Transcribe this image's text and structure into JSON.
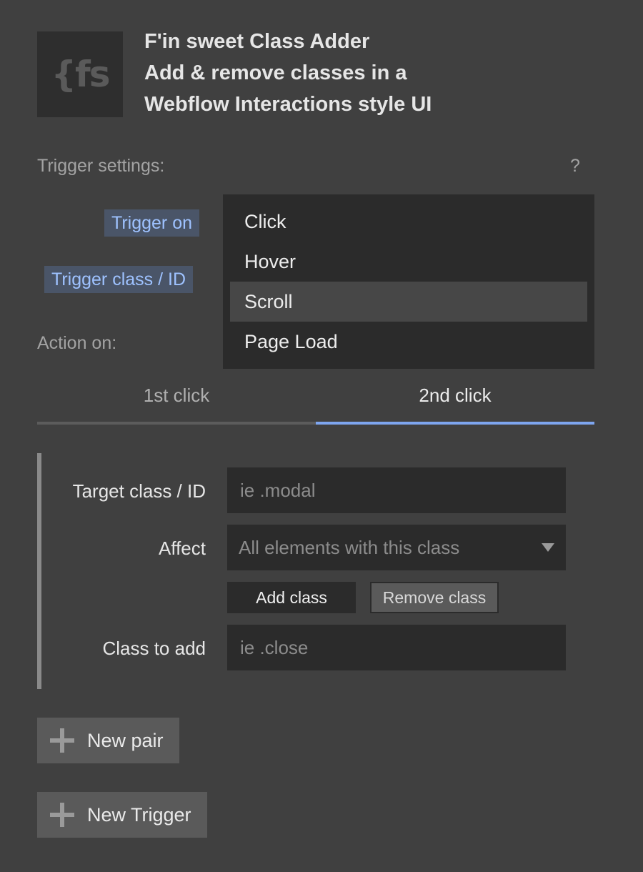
{
  "app": {
    "logo_text": "{fs",
    "title_lines": [
      "F'in sweet Class Adder",
      "Add & remove classes in a",
      "Webflow Interactions style UI"
    ]
  },
  "trigger_settings": {
    "label": "Trigger settings:",
    "help": "?",
    "trigger_on_label": "Trigger on",
    "trigger_class_label": "Trigger class / ID",
    "action_on_label": "Action on:",
    "dropdown_options": [
      "Click",
      "Hover",
      "Scroll",
      "Page Load"
    ],
    "highlighted_option": "Scroll"
  },
  "tabs": [
    {
      "label": "1st click",
      "active": false
    },
    {
      "label": "2nd click",
      "active": true
    }
  ],
  "pair": {
    "target_label": "Target class / ID",
    "target_placeholder": "ie .modal",
    "affect_label": "Affect",
    "affect_value": "All elements with this class",
    "add_class_button": "Add class",
    "remove_class_button": "Remove class",
    "class_to_add_label": "Class to add",
    "class_placeholder": "ie .close"
  },
  "buttons": {
    "new_pair": "New pair",
    "new_trigger": "New Trigger"
  },
  "colors": {
    "background": "#404040",
    "panel": "#2b2b2b",
    "accent": "#7ea6f0",
    "pill_bg": "#4a5568",
    "pill_text": "#9ec2ff"
  }
}
